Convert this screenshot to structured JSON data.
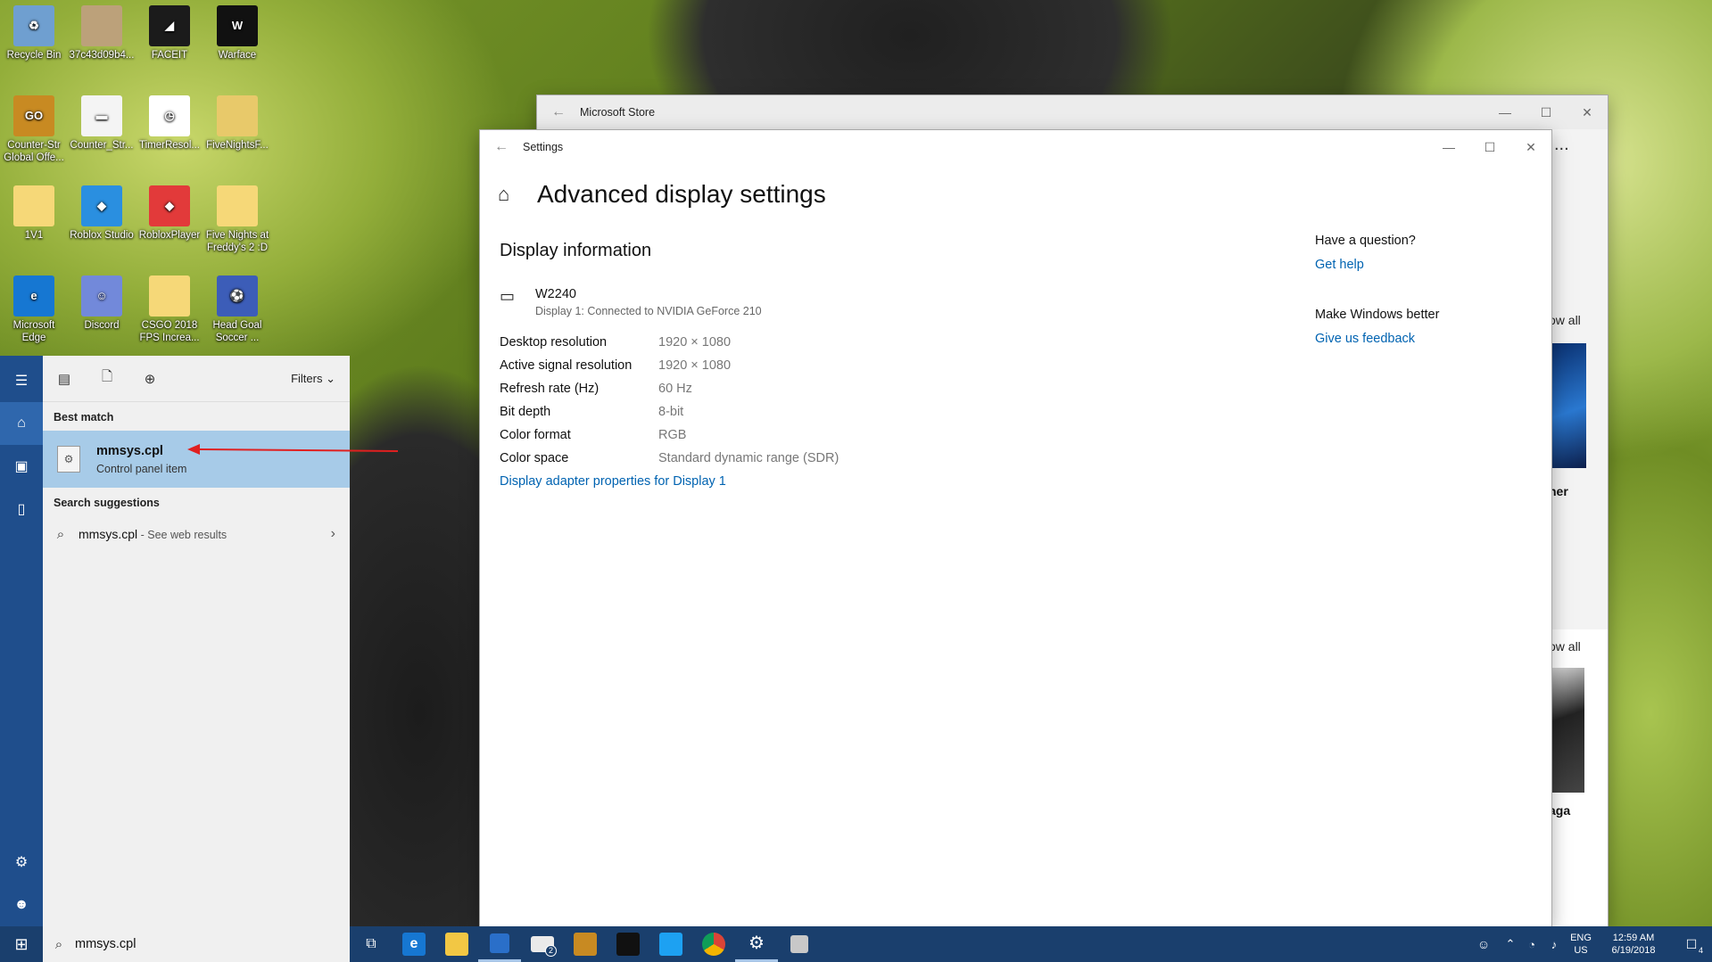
{
  "desktop": {
    "icons": [
      {
        "label": "Recycle Bin",
        "color": "#6f9fd0",
        "glyph": "♻"
      },
      {
        "label": "37c43d09b4...",
        "color": "#bca17a",
        "glyph": ""
      },
      {
        "label": "FACEIT",
        "color": "#1b1b1b",
        "glyph": "◢"
      },
      {
        "label": "Warface",
        "color": "#111111",
        "glyph": "W"
      },
      {
        "label": "Counter-Str Global Offe...",
        "color": "#c88a22",
        "glyph": "GO"
      },
      {
        "label": "Counter_Str...",
        "color": "#f4f4f4",
        "glyph": "▬"
      },
      {
        "label": "TimerResol...",
        "color": "#ffffff",
        "glyph": "◷"
      },
      {
        "label": "FiveNightsF...",
        "color": "#e8c96a",
        "glyph": ""
      },
      {
        "label": "1V1",
        "color": "#f6d878",
        "glyph": ""
      },
      {
        "label": "Roblox Studio",
        "color": "#2a8fe0",
        "glyph": "◆"
      },
      {
        "label": "RobloxPlayer",
        "color": "#e23a3a",
        "glyph": "◆"
      },
      {
        "label": "Five Nights at Freddy's 2 :D",
        "color": "#f6d878",
        "glyph": ""
      },
      {
        "label": "Microsoft Edge",
        "color": "#1677d2",
        "glyph": "e"
      },
      {
        "label": "Discord",
        "color": "#7289da",
        "glyph": "☺"
      },
      {
        "label": "CSGO 2018 FPS Increa...",
        "color": "#f6d878",
        "glyph": ""
      },
      {
        "label": "Head Goal Soccer ...",
        "color": "#3c5db8",
        "glyph": "⚽"
      }
    ]
  },
  "store": {
    "title": "Microsoft Store",
    "dots": "...",
    "frag1": "ow all",
    "frag2": "her",
    "frag3": "ow all",
    "frag4": "aga"
  },
  "settings": {
    "title": "Settings",
    "page_title": "Advanced display settings",
    "section": "Display information",
    "monitor_name": "W2240",
    "monitor_sub": "Display 1: Connected to NVIDIA GeForce 210",
    "rows": [
      {
        "k": "Desktop resolution",
        "v": "1920 × 1080"
      },
      {
        "k": "Active signal resolution",
        "v": "1920 × 1080"
      },
      {
        "k": "Refresh rate (Hz)",
        "v": "60 Hz"
      },
      {
        "k": "Bit depth",
        "v": "8-bit"
      },
      {
        "k": "Color format",
        "v": "RGB"
      },
      {
        "k": "Color space",
        "v": "Standard dynamic range (SDR)"
      }
    ],
    "adapter_link": "Display adapter properties for Display 1",
    "question": "Have a question?",
    "get_help": "Get help",
    "better": "Make Windows better",
    "feedback": "Give us feedback"
  },
  "start": {
    "filters": "Filters",
    "best_match": "Best match",
    "result_title": "mmsys.cpl",
    "result_sub": "Control panel item",
    "suggestions": "Search suggestions",
    "suggest_main": "mmsys.cpl",
    "suggest_sub": " - See web results"
  },
  "taskbar": {
    "search_value": "mmsys.cpl",
    "lang1": "ENG",
    "lang2": "US",
    "time": "12:59 AM",
    "date": "6/19/2018",
    "mail_badge": "2",
    "notif_count": "4"
  },
  "colors": {
    "accent": "#0063b1",
    "start_rail": "#1f4e8c",
    "taskbar": "#1a3f6d",
    "highlight": "#a7cbe8",
    "arrow": "#e02020"
  }
}
